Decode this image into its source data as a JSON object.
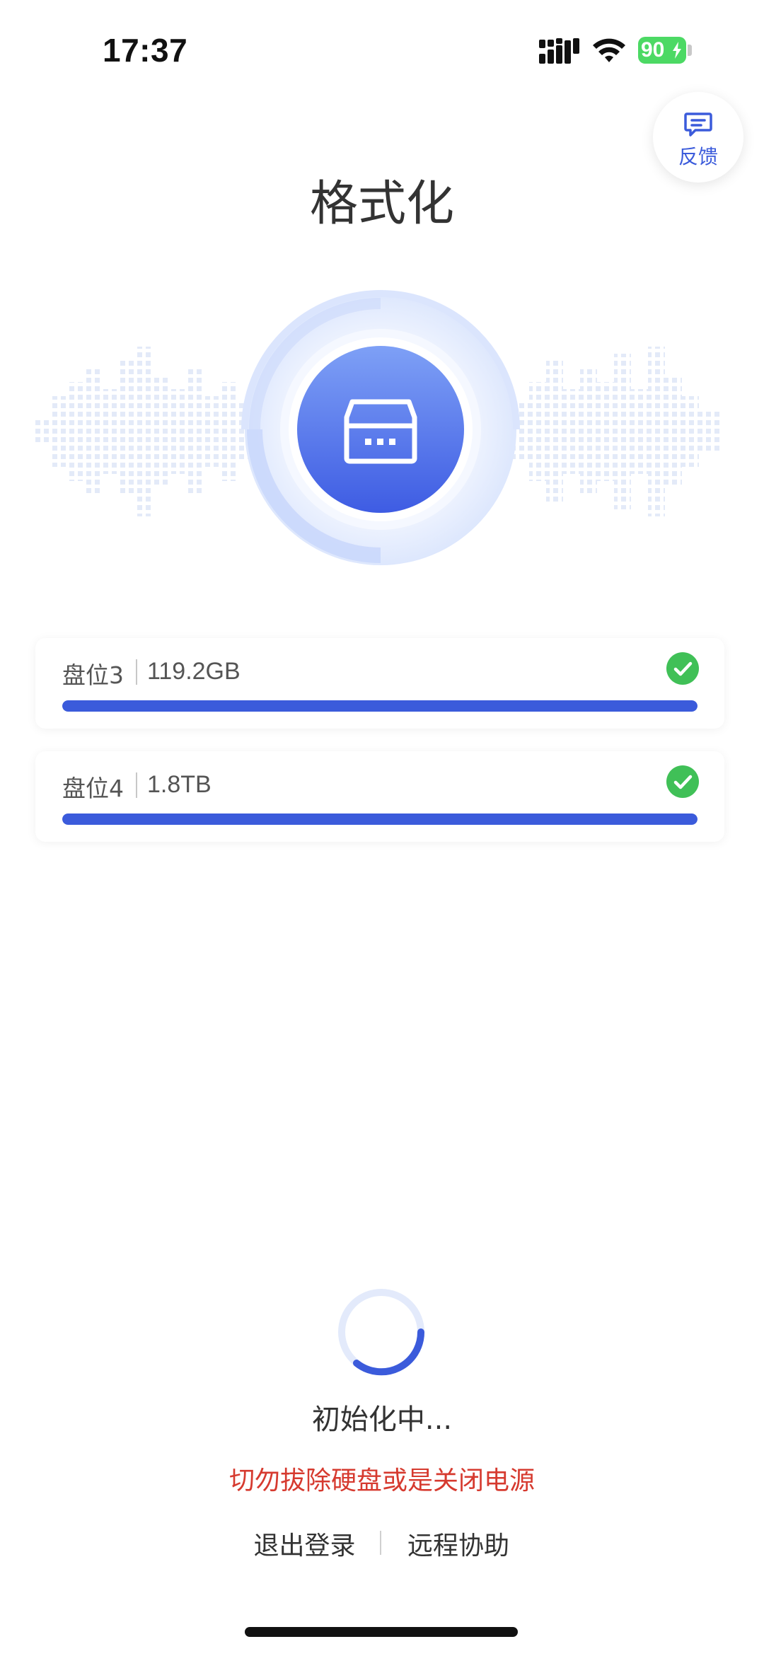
{
  "status_bar": {
    "time": "17:37",
    "battery": "90"
  },
  "feedback": {
    "label": "反馈",
    "icon": "message-icon"
  },
  "page": {
    "title": "格式化"
  },
  "hero": {
    "icon": "storage-box-icon"
  },
  "disks": [
    {
      "name": "盘位3",
      "size": "119.2GB",
      "progress": 1.0,
      "status": "done"
    },
    {
      "name": "盘位4",
      "size": "1.8TB",
      "progress": 1.0,
      "status": "done"
    }
  ],
  "loading": {
    "text": "初始化中...",
    "warning": "切勿拔除硬盘或是关闭电源"
  },
  "links": {
    "logout": "退出登录",
    "remote_help": "远程协助"
  },
  "colors": {
    "accent": "#3b5bdb",
    "success": "#40c057",
    "warning": "#d63a2f"
  }
}
